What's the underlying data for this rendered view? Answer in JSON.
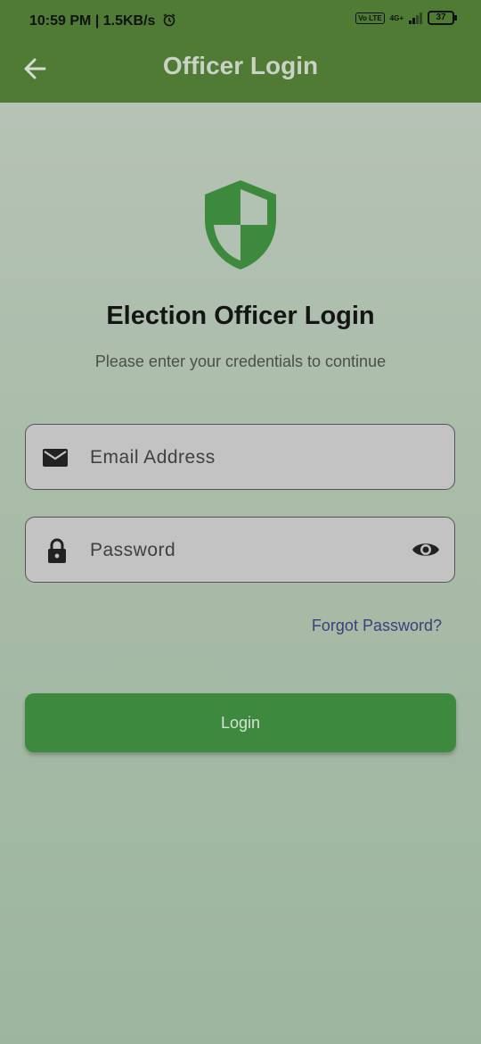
{
  "status_bar": {
    "time": "10:59 PM",
    "speed": "1.5KB/s",
    "network": "4G+",
    "volte": "Vo LTE",
    "battery": "37"
  },
  "app_bar": {
    "title": "Officer Login",
    "back_icon": "arrow-left-icon",
    "background_color": "#4f7b34"
  },
  "logo": {
    "icon": "shield-icon",
    "color": "#3d8a3e"
  },
  "main": {
    "heading": "Election Officer Login",
    "subheading": "Please enter your credentials to continue"
  },
  "form": {
    "email": {
      "placeholder": "Email Address",
      "value": "",
      "icon": "mail-icon"
    },
    "password": {
      "placeholder": "Password",
      "value": "",
      "icon": "lock-icon",
      "toggle_icon": "eye-icon"
    },
    "forgot_label": "Forgot Password?",
    "login_label": "Login",
    "accent_color": "#3d8a3e"
  }
}
